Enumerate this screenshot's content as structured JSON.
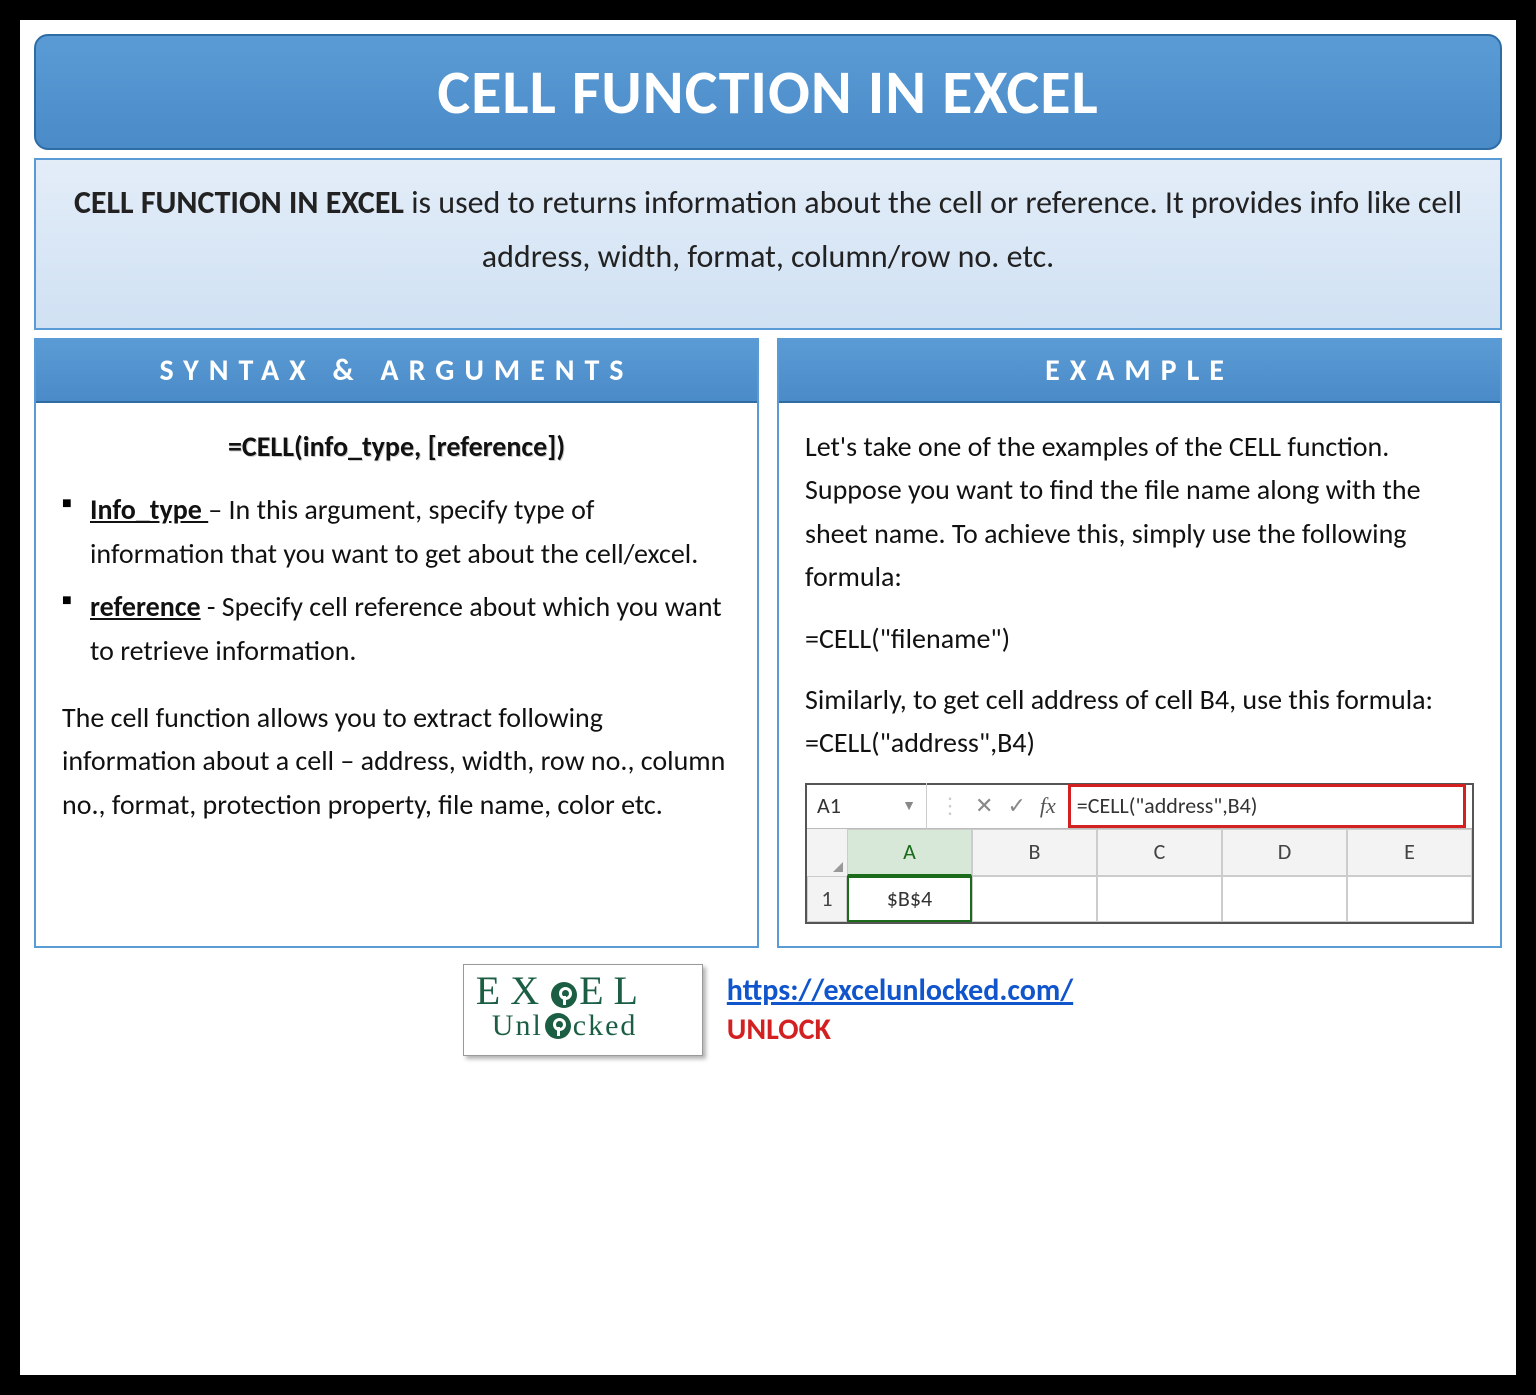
{
  "title": "CELL FUNCTION IN EXCEL",
  "description": {
    "strong": "CELL FUNCTION IN EXCEL",
    "rest": " is used to returns information about the cell or reference. It provides info like cell address, width, format, column/row no. etc."
  },
  "syntax": {
    "header": "SYNTAX & ARGUMENTS",
    "formula": "=CELL(info_type, [reference])",
    "args": [
      {
        "name": "Info_type ",
        "desc": "– In this argument, specify type of information that you want to get about the cell/excel."
      },
      {
        "name": "reference",
        "desc": " - Specify cell reference about which you want to retrieve information."
      }
    ],
    "note": "The cell function allows you to extract following information about a cell – address, width, row no., column no., format, protection property, file name, color etc."
  },
  "example": {
    "header": "EXAMPLE",
    "p1": "Let's take one of the examples of the CELL function. Suppose you want to find the file name along with the sheet name. To achieve this, simply use the following formula:",
    "p2": "=CELL(\"filename\")",
    "p3": "Similarly, to get cell address of cell B4, use this formula: =CELL(\"address\",B4)",
    "snippet": {
      "namebox": "A1",
      "fx_label": "fx",
      "formula": "=CELL(\"address\",B4)",
      "columns": [
        "A",
        "B",
        "C",
        "D",
        "E"
      ],
      "row_label": "1",
      "a1_value": "$B$4"
    }
  },
  "footer": {
    "logo_line1": "EX  EL",
    "logo_line2": "Unl  cked",
    "url": "https://excelunlocked.com/",
    "tag": "UNLOCK"
  }
}
